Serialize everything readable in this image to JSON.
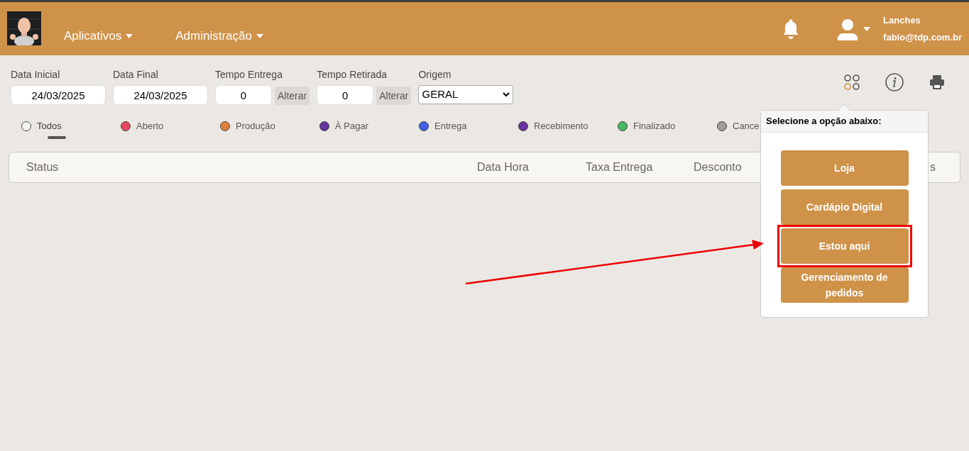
{
  "header": {
    "menus": [
      {
        "label": "Aplicativos"
      },
      {
        "label": "Administração"
      }
    ],
    "account": {
      "name": "Lanches",
      "email": "fabio@tdp.com.br"
    }
  },
  "filters": {
    "data_inicial": {
      "label": "Data Inicial",
      "value": "24/03/2025"
    },
    "data_final": {
      "label": "Data Final",
      "value": "24/03/2025"
    },
    "tempo_entrega": {
      "label": "Tempo Entrega",
      "value": "0",
      "button": "Alterar"
    },
    "tempo_retirada": {
      "label": "Tempo Retirada",
      "value": "0",
      "button": "Alterar"
    },
    "origem": {
      "label": "Origem",
      "value": "GERAL"
    }
  },
  "status_filters": [
    {
      "label": "Todos",
      "selected": true,
      "color": "#f5f3ef"
    },
    {
      "label": "Aberto",
      "selected": false,
      "color": "#e8475f"
    },
    {
      "label": "Produção",
      "selected": false,
      "color": "#e07f3c"
    },
    {
      "label": "À Pagar",
      "selected": false,
      "color": "#6633a0"
    },
    {
      "label": "Entrega",
      "selected": false,
      "color": "#4061e6"
    },
    {
      "label": "Recebimento",
      "selected": false,
      "color": "#6633a0"
    },
    {
      "label": "Finalizado",
      "selected": false,
      "color": "#47b862"
    },
    {
      "label": "Cance",
      "selected": false,
      "color": "#a09c9a"
    }
  ],
  "table": {
    "columns": [
      "Status",
      "Data Hora",
      "Taxa Entrega",
      "Desconto",
      "s"
    ]
  },
  "popover": {
    "title": "Selecione a opção abaixo:",
    "options": [
      {
        "label": "Loja",
        "highlighted": false
      },
      {
        "label": "Cardápio Digital",
        "highlighted": false
      },
      {
        "label": "Estou aqui",
        "highlighted": true
      },
      {
        "label": "Gerenciamento de pedidos",
        "highlighted": false
      }
    ]
  }
}
